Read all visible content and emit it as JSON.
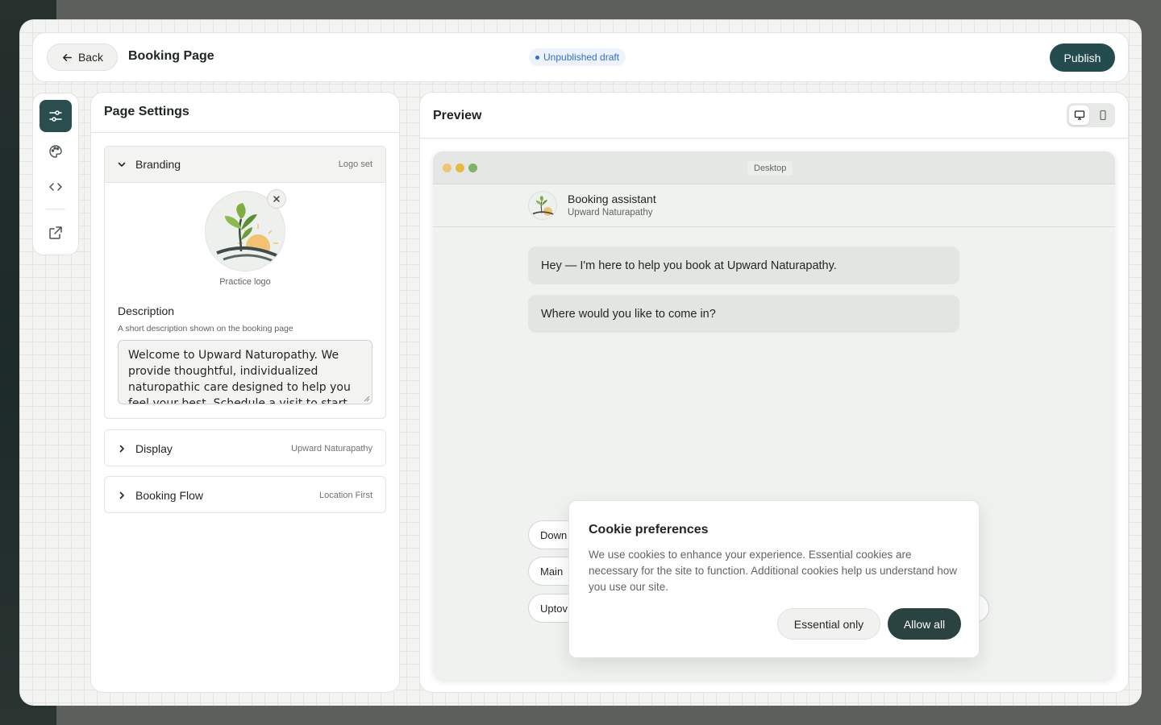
{
  "header": {
    "back_label": "Back",
    "title": "Booking Page",
    "status": "Unpublished draft",
    "publish_label": "Publish"
  },
  "rail": {
    "items": [
      "settings",
      "theme",
      "embed-code",
      "open-external"
    ]
  },
  "settings": {
    "title": "Page Settings",
    "branding": {
      "label": "Branding",
      "hint": "Logo set",
      "logo_caption": "Practice logo",
      "description_label": "Description",
      "description_help": "A short description shown on the booking page",
      "description_value": "Welcome to Upward Naturopathy. We provide thoughtful, individualized naturopathic care designed to help you feel your best. Schedule a visit to start working"
    },
    "display": {
      "label": "Display",
      "hint": "Upward Naturapathy"
    },
    "booking_flow": {
      "label": "Booking Flow",
      "hint": "Location First"
    }
  },
  "preview": {
    "title": "Preview",
    "device_label": "Desktop",
    "chat": {
      "title": "Booking assistant",
      "subtitle": "Upward Naturapathy",
      "messages": [
        "Hey — I'm here to help you book at Upward Naturapathy.",
        "Where would you like to come in?"
      ],
      "options": [
        "Down",
        "Main",
        "Uptov"
      ]
    }
  },
  "cookie": {
    "title": "Cookie preferences",
    "text": "We use cookies to enhance your experience. Essential cookies are necessary for the site to function. Additional cookies help us understand how you use our site.",
    "essential_label": "Essential only",
    "allow_label": "Allow all"
  },
  "colors": {
    "accent": "#244b4d",
    "status": "#2f6fd1",
    "canvas": "#f3f4f2"
  }
}
